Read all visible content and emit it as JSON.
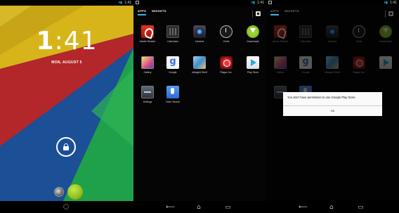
{
  "lockscreen": {
    "clock_hour": "1",
    "clock_minutes": ":41",
    "date": "MON, AUGUST 5"
  },
  "status_bar": {
    "time": "1:41"
  },
  "drawer": {
    "tab_apps": "APPS",
    "tab_widgets": "WIDGETS",
    "apps": [
      {
        "label": "Adobe Reader",
        "icon": "adobe-reader-icon"
      },
      {
        "label": "Calculator",
        "icon": "calculator-icon"
      },
      {
        "label": "Camera",
        "icon": "camera-icon"
      },
      {
        "label": "Clock",
        "icon": "clock-icon"
      },
      {
        "label": "Downloads",
        "icon": "downloads-icon"
      },
      {
        "label": "Gallery",
        "icon": "gallery-icon"
      },
      {
        "label": "Google",
        "icon": "google-icon"
      },
      {
        "label": "Ideagrid Shelf",
        "icon": "shelf-icon"
      },
      {
        "label": "Plague Inc.",
        "icon": "plague-icon"
      },
      {
        "label": "Play Store",
        "icon": "play-store-icon"
      },
      {
        "label": "Settings",
        "icon": "settings-icon"
      },
      {
        "label": "Voice Search",
        "icon": "voice-search-icon"
      }
    ]
  },
  "dialog": {
    "message": "You don't have permission to use Google Play Store.",
    "ok_label": "OK"
  },
  "colors": {
    "accent": "#33b5e5",
    "wallpaper_red": "#b3262a",
    "wallpaper_green": "#1fa04a",
    "wallpaper_blue": "#1e5ba8",
    "wallpaper_yellow": "#d7b51a"
  }
}
